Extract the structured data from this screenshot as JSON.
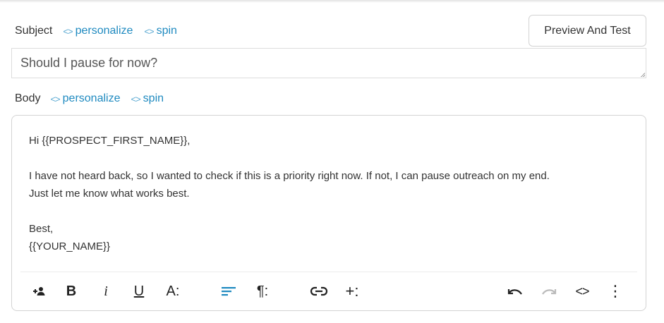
{
  "subject": {
    "label": "Subject",
    "personalize": "personalize",
    "spin": "spin",
    "code_glyph": "<>",
    "value": "Should I pause for now?"
  },
  "preview_button": "Preview And Test",
  "body": {
    "label": "Body",
    "personalize": "personalize",
    "spin": "spin",
    "code_glyph": "<>",
    "lines": [
      "Hi {{PROSPECT_FIRST_NAME}},",
      "",
      "I have not heard back, so I wanted to check if this is a priority right now. If not, I can pause outreach on my end.",
      "Just let me know what works best.",
      "",
      "Best,",
      "{{YOUR_NAME}}"
    ]
  },
  "toolbar": {
    "bold": "B",
    "italic": "i",
    "underline": "U",
    "font_size": "A:",
    "paragraph": "¶:",
    "insert": "+:",
    "code": "<>",
    "more": "⋮",
    "icons": [
      "add-person-icon",
      "bold-icon",
      "italic-icon",
      "underline-icon",
      "font-size-icon",
      "align-left-icon",
      "paragraph-icon",
      "link-icon",
      "insert-icon",
      "undo-icon",
      "redo-icon",
      "code-view-icon",
      "more-icon"
    ],
    "colors": {
      "accent": "#1f8ac0",
      "icon": "#222222",
      "disabled": "#bbbbbb"
    }
  }
}
